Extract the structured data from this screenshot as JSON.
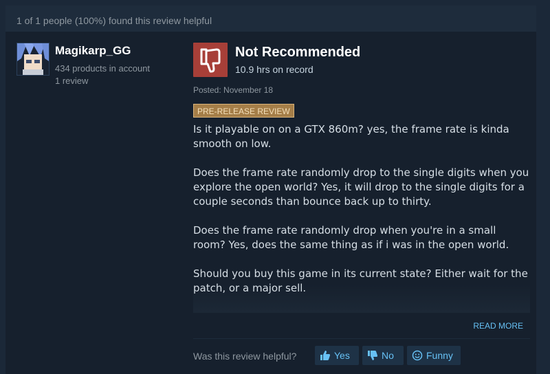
{
  "review": {
    "helpful_header": "1 of 1 people (100%) found this review helpful",
    "author": {
      "name": "Magikarp_GG",
      "products": "434 products in account",
      "reviews": "1 review",
      "avatar_icon": "avatar"
    },
    "verdict": "Not Recommended",
    "verdict_icon": "thumbs-down-icon",
    "hours": "10.9 hrs on record",
    "posted": "Posted: November 18",
    "badge": "PRE-RELEASE REVIEW",
    "paragraphs": [
      "Is it playable on on a GTX 860m? yes, the frame rate is kinda smooth on low.",
      "Does the frame rate randomly drop to the single digits when you explore the open world? Yes, it will drop to the single digits for a couple seconds than bounce back up to thirty.",
      "Does the frame rate randomly drop when you're in a small room? Yes, does the same thing as if i was in the open world.",
      "Should you buy this game in its current state? Either wait for the patch, or a major sell."
    ],
    "read_more": "READ MORE",
    "helpful_question": "Was this review helpful?",
    "buttons": {
      "yes": "Yes",
      "no": "No",
      "funny": "Funny"
    }
  },
  "colors": {
    "background": "#1b2838",
    "panel": "#16202d",
    "thumbs_down": "#a73f38",
    "accent_link": "#66c0f4",
    "badge": "#a57e48"
  }
}
